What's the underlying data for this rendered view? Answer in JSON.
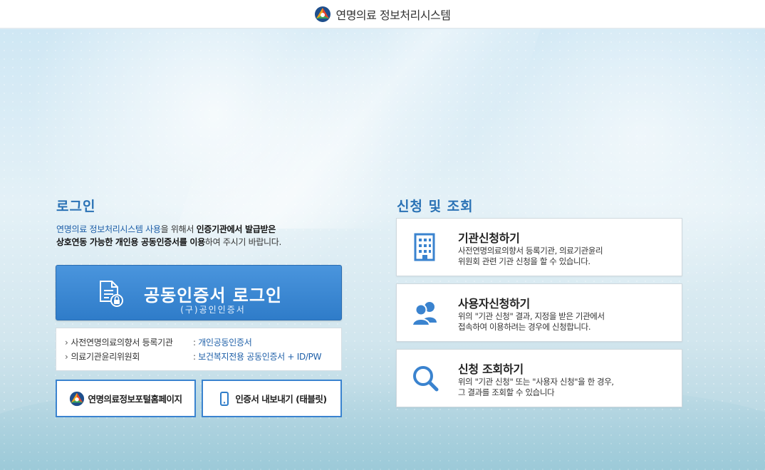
{
  "header": {
    "site_name": "연명의료 정보처리시스템",
    "logo_icon": "triangle-logo-icon"
  },
  "login": {
    "title": "로그인",
    "desc_part1": "연명의료 정보처리시스템 사용",
    "desc_part2": "을 위해서 ",
    "desc_part3": "인증기관에서 발급받은",
    "desc_part4": "상호연동 가능한 개인용 공동인증서를 이용",
    "desc_part5": "하여 주시기 바랍니다.",
    "cert_button": {
      "title": "공동인증서 로그인",
      "subtitle": "(구)공인인증서",
      "icon": "certificate-document-lock-icon"
    },
    "info": [
      {
        "label": "사전연명의료의향서 등록기관",
        "value": "개인공동인증서"
      },
      {
        "label": "의료기관윤리위원회",
        "value": "보건복지전용 공동인증서 + ID/PW"
      }
    ],
    "portal_button": {
      "label": "연명의료정보포털홈페이지",
      "icon": "triangle-logo-icon"
    },
    "export_button": {
      "label": "인증서 내보내기 (태블릿)",
      "icon": "smartphone-icon"
    }
  },
  "apply": {
    "title": "신청 및 조회",
    "cards": [
      {
        "title": "기관신청하기",
        "desc_line1": "사전연명의료의향서 등록기관, 의료기관윤리",
        "desc_line2": "위원회 관련 기관 신청을 할 수 있습니다.",
        "icon": "building-icon"
      },
      {
        "title": "사용자신청하기",
        "desc_line1": "위의 \"기관 신청\" 결과, 지정을 받은 기관에서",
        "desc_line2": "접속하여 이용하려는 경우에 신청합니다.",
        "icon": "users-icon"
      },
      {
        "title": "신청 조회하기",
        "desc_line1": "위의 \"기관 신청\" 또는 \"사용자 신청\"을 한 경우,",
        "desc_line2": "그 결과를 조회할 수 있습니다",
        "icon": "search-icon"
      }
    ]
  },
  "colors": {
    "accent": "#2a72b5",
    "button_blue": "#3a83cf",
    "link_blue": "#1e5fa8"
  }
}
